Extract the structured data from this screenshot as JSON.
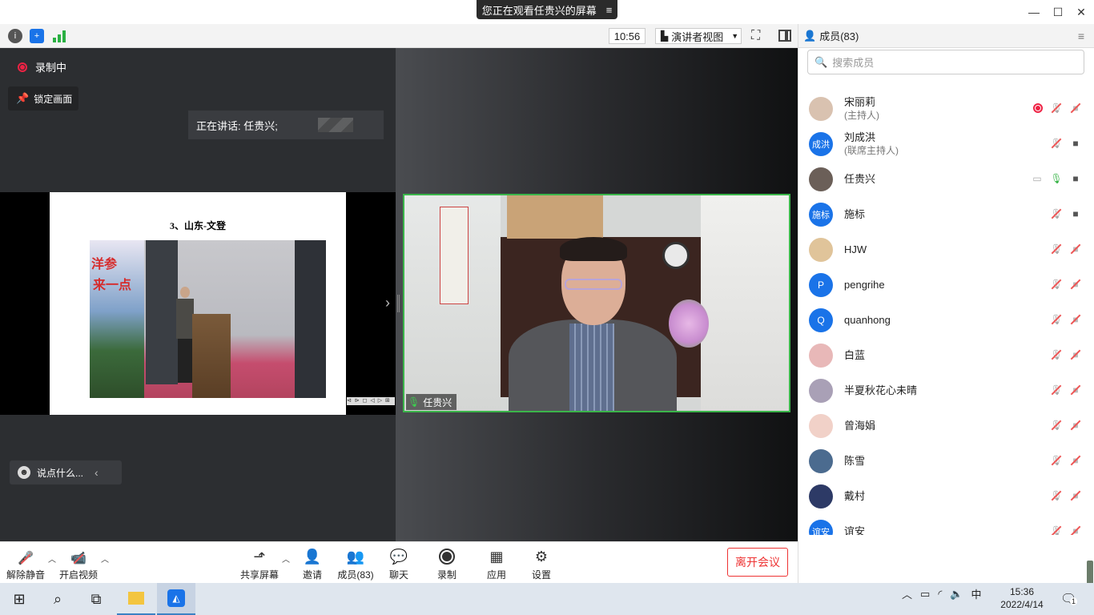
{
  "banner": {
    "text": "您正在观看任贵兴的屏幕",
    "menu_icon": "menu-lines-icon"
  },
  "window": {
    "minimize": "—",
    "maximize": "☐",
    "close": "✕"
  },
  "toolbar": {
    "time": "10:56",
    "view_label": "演讲者视图"
  },
  "stage": {
    "recording_label": "录制中",
    "lock_label": "锁定画面",
    "speaking_label": "正在讲话: 任贵兴;",
    "slide_title": "3、山东-文登",
    "slide_photo_text1": "洋参",
    "slide_photo_text2": "来一点",
    "slide_controls": "⊲ ⊳ ◻ ◁ ▷ ⊞",
    "video_name": "任贵兴",
    "chat_placeholder": "说点什么...",
    "expand_arrow": "›",
    "chat_collapse": "‹"
  },
  "controls": {
    "unmute": "解除静音",
    "video": "开启视频",
    "share": "共享屏幕",
    "invite": "邀请",
    "members": "成员(83)",
    "chat": "聊天",
    "record": "录制",
    "apps": "应用",
    "settings": "设置",
    "leave": "离开会议"
  },
  "panel": {
    "title": "成员(83)",
    "search_placeholder": "搜索成员",
    "members": [
      {
        "name": "宋丽莉",
        "role": "(主持人)",
        "avatar": "photo",
        "color": "#d9c2b0"
      },
      {
        "name": "刘成洪",
        "role": "(联席主持人)",
        "avatar": "成洪",
        "color": "#1a73e8"
      },
      {
        "name": "任贵兴",
        "role": "",
        "avatar": "photo",
        "color": "#6b5f58"
      },
      {
        "name": "施标",
        "role": "",
        "avatar": "施标",
        "color": "#1a73e8"
      },
      {
        "name": "HJW",
        "role": "",
        "avatar": "photo",
        "color": "#e0c49a"
      },
      {
        "name": "pengrihe",
        "role": "",
        "avatar": "P",
        "color": "#1a73e8"
      },
      {
        "name": "quanhong",
        "role": "",
        "avatar": "Q",
        "color": "#1a73e8"
      },
      {
        "name": "白蓝",
        "role": "",
        "avatar": "photo",
        "color": "#e8b8b8"
      },
      {
        "name": "半夏秋花心未晴",
        "role": "",
        "avatar": "photo",
        "color": "#a9a0b6"
      },
      {
        "name": "曾海娟",
        "role": "",
        "avatar": "photo",
        "color": "#f1d1c8"
      },
      {
        "name": "陈雪",
        "role": "",
        "avatar": "photo",
        "color": "#4b6b8f"
      },
      {
        "name": "戴村",
        "role": "",
        "avatar": "photo",
        "color": "#2d3a66"
      },
      {
        "name": "谊安",
        "role": "",
        "avatar": "谊安",
        "color": "#1a73e8"
      }
    ]
  },
  "taskbar": {
    "ime": "中",
    "time": "15:36",
    "date": "2022/4/14",
    "notification_count": "1"
  }
}
